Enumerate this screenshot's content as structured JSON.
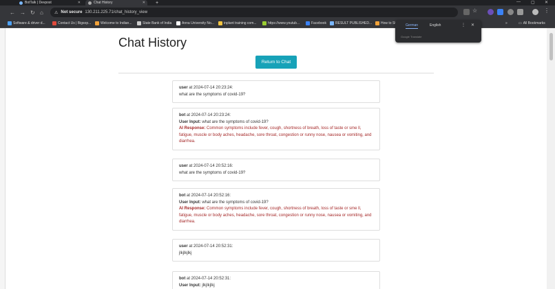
{
  "browser": {
    "tabs": [
      {
        "title": "BotTalk | Devpost",
        "active": false
      },
      {
        "title": "Chat History",
        "active": true
      }
    ],
    "new_tab": "+",
    "security_label": "Not secure",
    "url": "130.211.225.71/chat_history_view",
    "bookmarks": [
      {
        "label": "Software & driver d...",
        "color": "#4fa3f7"
      },
      {
        "label": "Contact Us | Bigsop...",
        "color": "#e04a3b"
      },
      {
        "label": "Welcome to Indian...",
        "color": "#f2a33a"
      },
      {
        "label": "State Bank of India",
        "color": "#cccccc"
      },
      {
        "label": "Anna University No...",
        "color": "#ffffff"
      },
      {
        "label": "inplant training com...",
        "color": "#f4c542"
      },
      {
        "label": "https://www.youtub...",
        "color": "#9acd32"
      },
      {
        "label": "Facebook",
        "color": "#3b82f6"
      },
      {
        "label": "RESULT PUBLISHED...",
        "color": "#7ab7ff"
      },
      {
        "label": "How to St...",
        "color": "#f2a33a"
      }
    ],
    "all_bookmarks": "All Bookmarks",
    "more_bookmarks": "»"
  },
  "translate_popup": {
    "languages": [
      "German",
      "English"
    ],
    "selected": "German",
    "footer": "Google Translate"
  },
  "page": {
    "title": "Chat History",
    "return_button": "Return to Chat",
    "messages": [
      {
        "sender": "user",
        "at": "at 2024-07-14 20:23:24:",
        "text": "what are the symptoms of covid-19?"
      },
      {
        "sender": "bot",
        "at": "at 2024-07-14 20:23:24:",
        "user_input_label": "User Input:",
        "user_input": "what are the symptoms of covid-19?",
        "ai_label": "AI Response:",
        "ai_response": "Common symptoms include fever, cough, shortness of breath, loss of taste or sme ll, fatigue, muscle or body aches, headache, sore throat, congestion or runny nose, nausea or vomiting, and diarrhea."
      },
      {
        "sender": "user",
        "at": "at 2024-07-14 20:52:16:",
        "text": "what are the symptoms of covid-19?"
      },
      {
        "sender": "bot",
        "at": "at 2024-07-14 20:52:16:",
        "user_input_label": "User Input:",
        "user_input": "what are the symptoms of covid-19?",
        "ai_label": "AI Response:",
        "ai_response": "Common symptoms include fever, cough, shortness of breath, loss of taste or sme ll, fatigue, muscle or body aches, headache, sore throat, congestion or runny nose, nausea or vomiting, and diarrhea."
      },
      {
        "sender": "user",
        "at": "at 2024-07-14 20:52:31:",
        "text": "jlkjlkjlkj"
      },
      {
        "sender": "bot",
        "at": "at 2024-07-14 20:52:31:",
        "user_input_label": "User Input:",
        "user_input": "jlkjlkjlkj"
      }
    ]
  },
  "colors": {
    "accent_button": "#17a2b8",
    "ai_response": "#a52828",
    "browser_chrome": "#35363a"
  }
}
